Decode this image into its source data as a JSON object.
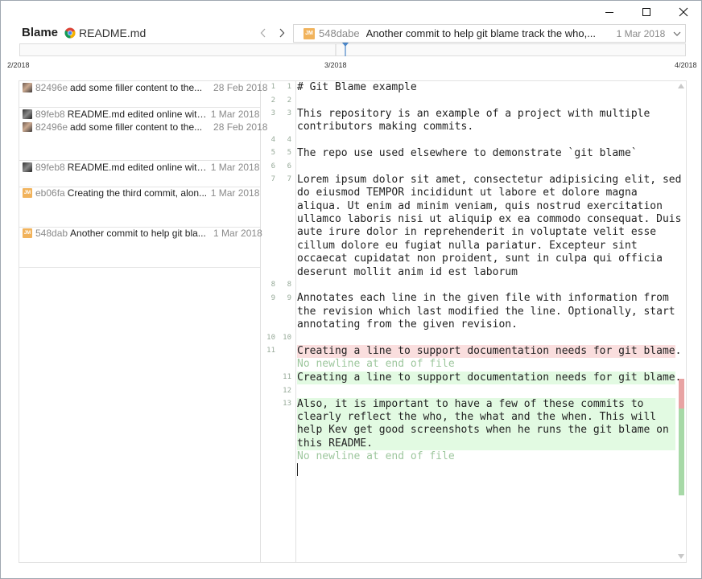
{
  "header": {
    "title": "Blame",
    "file_name": "README.md"
  },
  "commit_selector": {
    "avatar_initials": "JM",
    "sha": "548dabe",
    "message": "Another commit to help git blame track the who,...",
    "date": "1 Mar 2018"
  },
  "timeline": {
    "labels": [
      "2/2018",
      "3/2018",
      "4/2018"
    ],
    "marker_color": "#4a86c8"
  },
  "blame_rows": [
    {
      "avatar": "photo",
      "sha": "82496e",
      "message": "add some filler content to the...",
      "date": "28 Feb 2018"
    },
    {
      "avatar": "dark",
      "sha": "89feb8",
      "message": "README.md edited online with...",
      "date": "1 Mar 2018"
    },
    {
      "avatar": "photo",
      "sha": "82496e",
      "message": "add some filler content to the...",
      "date": "28 Feb 2018"
    },
    {
      "avatar": "dark",
      "sha": "89feb8",
      "message": "README.md edited online with...",
      "date": "1 Mar 2018"
    },
    {
      "avatar": "JM",
      "sha": "eb06fa",
      "message": "Creating the third commit, alon...",
      "date": "1 Mar 2018"
    },
    {
      "avatar": "JM",
      "sha": "548dab",
      "message": "Another commit to help git bla...",
      "date": "1 Mar 2018"
    }
  ],
  "line_numbers": [
    {
      "old": "1",
      "new": "1"
    },
    {
      "old": "2",
      "new": "2"
    },
    {
      "old": "3",
      "new": "3"
    },
    {
      "old": "4",
      "new": "4"
    },
    {
      "old": "5",
      "new": "5"
    },
    {
      "old": "6",
      "new": "6"
    },
    {
      "old": "7",
      "new": "7"
    },
    {
      "old": "8",
      "new": "8"
    },
    {
      "old": "9",
      "new": "9"
    },
    {
      "old": "10",
      "new": "10"
    },
    {
      "old": "11",
      "new": ""
    },
    {
      "old": "",
      "new": "11"
    },
    {
      "old": "",
      "new": "12"
    },
    {
      "old": "",
      "new": "13"
    }
  ],
  "code_lines": [
    "# Git Blame example",
    "",
    "This repository is an example of a project with multiple",
    "contributors making commits.",
    "",
    "The repo use used elsewhere to demonstrate `git blame`",
    "",
    "Lorem ipsum dolor sit amet, consectetur adipisicing elit, sed",
    "do eiusmod TEMPOR incididunt ut labore et dolore magna",
    "aliqua. Ut enim ad minim veniam, quis nostrud exercitation",
    "ullamco laboris nisi ut aliquip ex ea commodo consequat. Duis",
    "aute irure dolor in reprehenderit in voluptate velit esse",
    "cillum dolore eu fugiat nulla pariatur. Excepteur sint",
    "occaecat cupidatat non proident, sunt in culpa qui officia",
    "deserunt mollit anim id est laborum",
    "",
    "Annotates each line in the given file with information from",
    "the revision which last modified the line. Optionally, start",
    "annotating from the given revision.",
    "",
    "Creating a line to support documentation needs for git blame.",
    "No newline at end of file",
    "Creating a line to support documentation needs for git blame.",
    "",
    "Also, it is important to have a few of these commits to",
    "clearly reflect the who, the what and the when. This will",
    "help Kev get good screenshots when he runs the git blame on",
    "this README.",
    "No newline at end of file"
  ],
  "colors": {
    "deleted_bg": "#fadede",
    "added_bg": "#e2fae2",
    "deleted_marker": "#e8a3a3",
    "added_marker": "#a7d9a7",
    "jm_avatar": "#f1b35c"
  }
}
